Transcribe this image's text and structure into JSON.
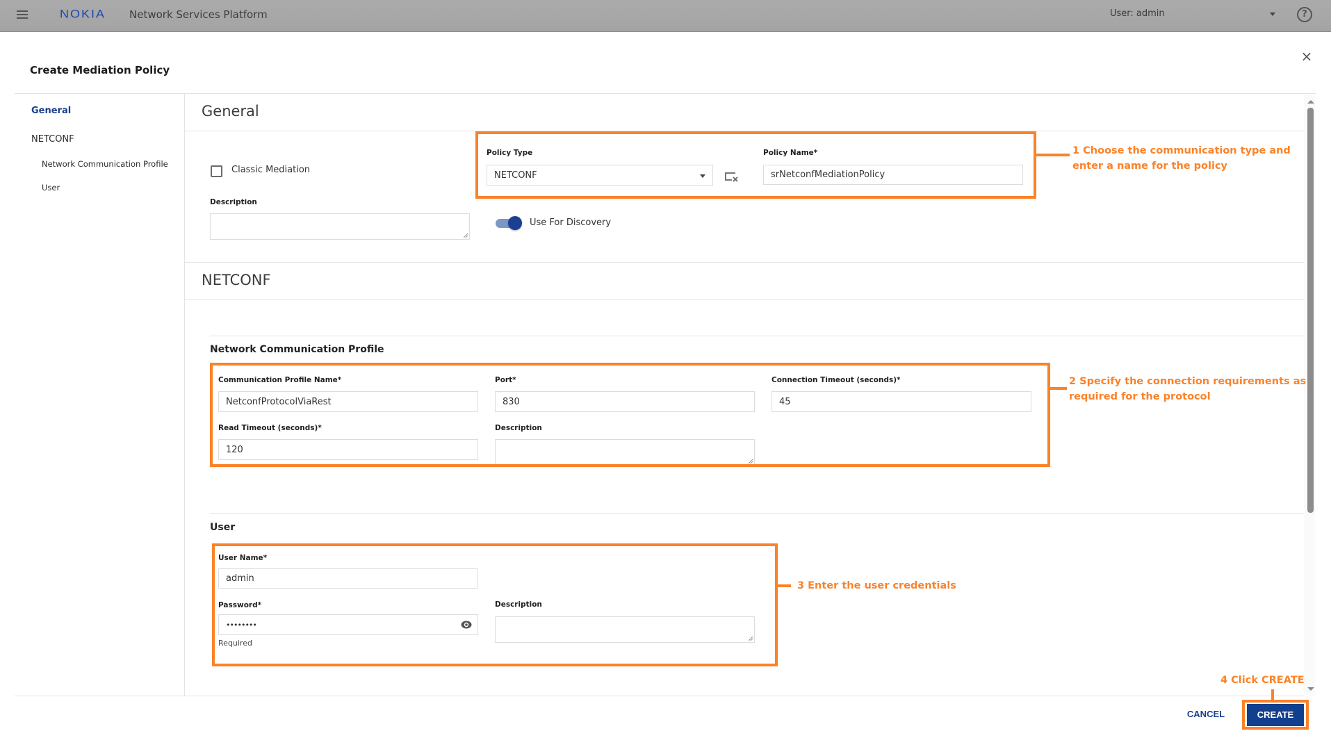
{
  "header": {
    "menu_icon": "hamburger-icon",
    "logo": "NOKIA",
    "app_title": "Network Services Platform",
    "user_label": "User: admin",
    "help_icon": "help-icon"
  },
  "dialog": {
    "title": "Create Mediation Policy",
    "close_icon": "close-icon",
    "close_glyph": "×"
  },
  "nav": {
    "items": [
      {
        "label": "General",
        "active": true
      },
      {
        "label": "NETCONF",
        "active": false
      },
      {
        "label": "Network Communication Profile",
        "active": false
      },
      {
        "label": "User",
        "active": false
      }
    ]
  },
  "general": {
    "heading": "General",
    "classic_mediation": {
      "label": "Classic Mediation",
      "checked": false
    },
    "description": {
      "label": "Description",
      "value": ""
    },
    "policy_type": {
      "label": "Policy Type",
      "value": "NETCONF"
    },
    "policy_name": {
      "label": "Policy Name*",
      "value": "srNetconfMediationPolicy"
    },
    "use_for_discovery": {
      "label": "Use For Discovery",
      "on": true
    }
  },
  "netconf": {
    "heading": "NETCONF",
    "ncp": {
      "heading": "Network Communication Profile",
      "profile_name": {
        "label": "Communication Profile Name*",
        "value": "NetconfProtocolViaRest"
      },
      "port": {
        "label": "Port*",
        "value": "830"
      },
      "connection_timeout": {
        "label": "Connection Timeout (seconds)*",
        "value": "45"
      },
      "read_timeout": {
        "label": "Read Timeout (seconds)*",
        "value": "120"
      },
      "description": {
        "label": "Description",
        "value": ""
      }
    },
    "user": {
      "heading": "User",
      "user_name": {
        "label": "User Name*",
        "value": "admin"
      },
      "password": {
        "label": "Password*",
        "value": "••••••••",
        "hint": "Required"
      },
      "description": {
        "label": "Description",
        "value": ""
      }
    }
  },
  "annotations": {
    "step1": "1  Choose the communication type and enter a name for the policy",
    "step1_line1": "1  Choose the communication type and",
    "step1_line2": "enter a name for the policy",
    "step2_line1": "2  Specify the connection requirements as",
    "step2_line2": "required for the protocol",
    "step3": "3  Enter the user credentials",
    "step4": "4  Click CREATE",
    "color": "#fb8228"
  },
  "footer": {
    "cancel_label": "CANCEL",
    "create_label": "CREATE"
  },
  "colors": {
    "header_bg": "#a8a8a8",
    "brand_blue": "#1a49b5",
    "primary_button": "#12408f",
    "nav_active": "#1b3e8a",
    "annotation": "#fb8228"
  }
}
